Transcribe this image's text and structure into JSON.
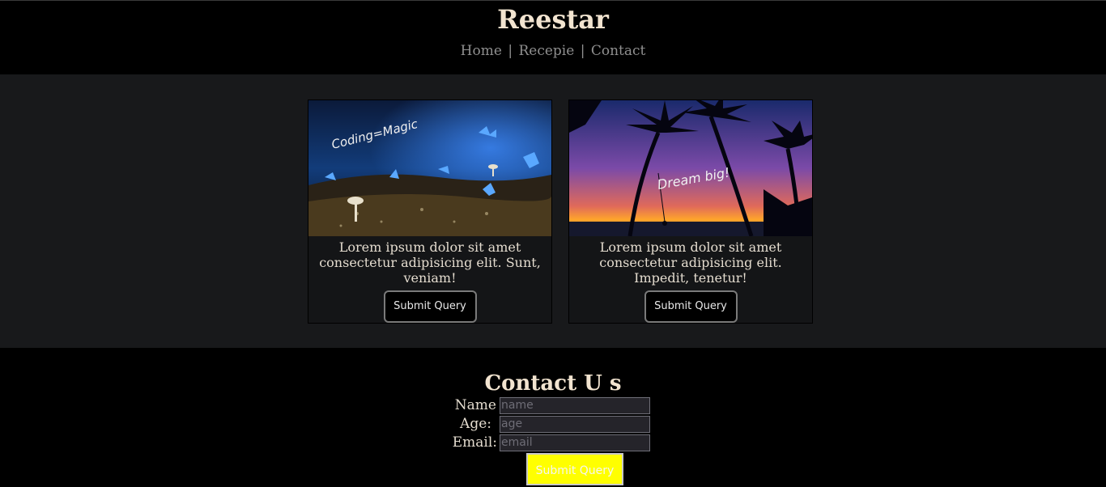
{
  "site": {
    "brand": "Reestar",
    "nav": [
      {
        "label": "Home"
      },
      {
        "label": "Recepie"
      },
      {
        "label": "Contact"
      }
    ],
    "nav_separator": "|"
  },
  "cards": [
    {
      "image_caption": "Coding=Magic",
      "text": "Lorem ipsum dolor sit amet consectetur adipisicing elit. Sunt, veniam!",
      "button": "Submit Query"
    },
    {
      "image_caption": "Dream big!",
      "text": "Lorem ipsum dolor sit amet consectetur adipisicing elit. Impedit, tenetur!",
      "button": "Submit Query"
    }
  ],
  "contact": {
    "title": "Contact U s",
    "fields": [
      {
        "label": "Name",
        "placeholder": "name"
      },
      {
        "label": "Age:",
        "placeholder": "age"
      },
      {
        "label": "Email:",
        "placeholder": "email"
      }
    ],
    "submit": "Submit Query"
  },
  "colors": {
    "background": "#000000",
    "section": "#18191b",
    "heading": "#f2e4d0",
    "nav_link": "#8f8f8f",
    "submit_bg": "#ffff00"
  }
}
